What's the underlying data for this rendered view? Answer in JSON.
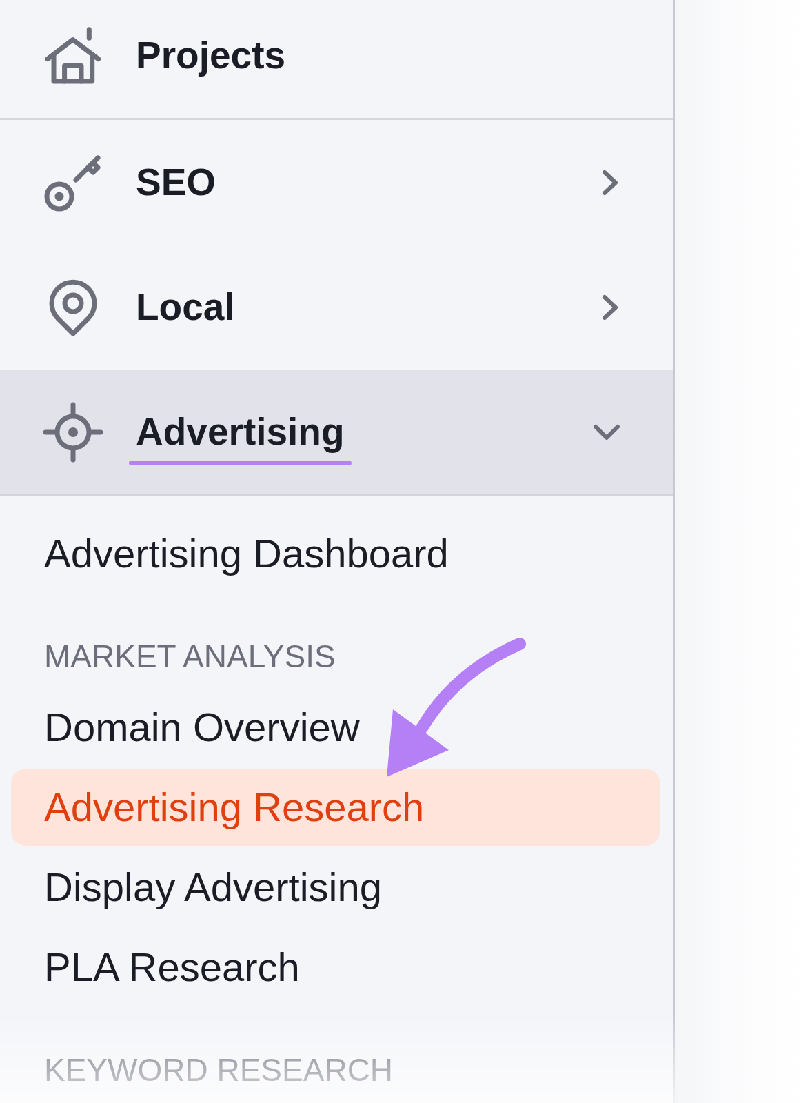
{
  "sidebar": {
    "sections": [
      {
        "items": [
          {
            "kind": "link",
            "label": "Projects",
            "selected": false
          }
        ]
      },
      {
        "items": [
          {
            "kind": "group",
            "label": "SEO",
            "expanded": false,
            "selected": false
          },
          {
            "kind": "group",
            "label": "Local",
            "expanded": false,
            "selected": false
          },
          {
            "kind": "group",
            "label": "Advertising",
            "expanded": true,
            "selected": true,
            "children": [
              {
                "kind": "link",
                "label": "Advertising Dashboard",
                "selected": false
              },
              {
                "kind": "heading",
                "label": "MARKET ANALYSIS"
              },
              {
                "kind": "link",
                "label": "Domain Overview",
                "selected": false
              },
              {
                "kind": "link",
                "label": "Advertising Research",
                "selected": true
              },
              {
                "kind": "link",
                "label": "Display Advertising",
                "selected": false
              },
              {
                "kind": "link",
                "label": "PLA Research",
                "selected": false
              },
              {
                "kind": "heading",
                "label": "KEYWORD RESEARCH"
              }
            ]
          }
        ]
      }
    ]
  }
}
